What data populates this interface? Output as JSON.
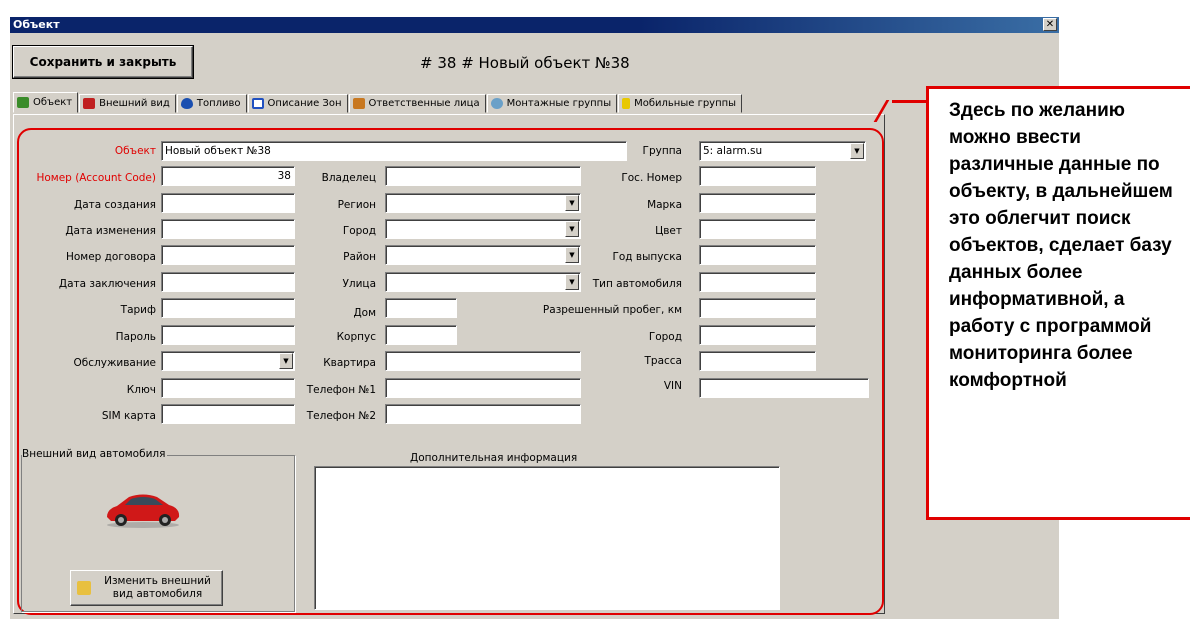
{
  "window": {
    "title": "Объект",
    "close_icon": "close-icon"
  },
  "toolbar": {
    "save_label": "Сохранить и закрыть"
  },
  "heading": "# 38 # Новый объект №38",
  "tabs": [
    {
      "label": "Объект",
      "icon": "car-icon",
      "color": "#3a8c2a"
    },
    {
      "label": "Внешний вид",
      "icon": "car-red-icon",
      "color": "#c02020"
    },
    {
      "label": "Топливо",
      "icon": "fuel-drop-icon",
      "color": "#1a4fb0"
    },
    {
      "label": "Описание Зон",
      "icon": "zone-icon",
      "color": "#2050c0"
    },
    {
      "label": "Ответственные лица",
      "icon": "people-icon",
      "color": "#c87820"
    },
    {
      "label": "Монтажные группы",
      "icon": "gear-icon",
      "color": "#6aa0c8"
    },
    {
      "label": "Мобильные группы",
      "icon": "lightning-icon",
      "color": "#e8c800"
    }
  ],
  "form": {
    "object_label": "Объект",
    "object_value": "Новый объект №38",
    "group_label": "Группа",
    "group_value": "5: alarm.su",
    "number_label": "Номер (Account Code)",
    "number_value": "38",
    "owner_label": "Владелец",
    "gos_label": "Гос. Номер",
    "created_label": "Дата создания",
    "region_label": "Регион",
    "brand_label": "Марка",
    "changed_label": "Дата изменения",
    "city_label": "Город",
    "color_label": "Цвет",
    "contract_label": "Номер договора",
    "district_label": "Район",
    "year_label": "Год выпуска",
    "contract_date_label": "Дата заключения",
    "street_label": "Улица",
    "cartype_label": "Тип автомобиля",
    "tariff_label": "Тариф",
    "house_label": "Дом",
    "mileage_label": "Разрешенный пробег, км",
    "password_label": "Пароль",
    "building_label": "Корпус",
    "city2_label": "Город",
    "service_label": "Обслуживание",
    "flat_label": "Квартира",
    "route_label": "Трасса",
    "key_label": "Ключ",
    "phone1_label": "Телефон №1",
    "vin_label": "VIN",
    "sim_label": "SIM карта",
    "phone2_label": "Телефон №2"
  },
  "appearance": {
    "group_label": "Внешний вид автомобиля",
    "change_button": "Изменить внешний вид автомобиля"
  },
  "extra_label": "Дополнительная информация",
  "note": "Здесь по желанию можно ввести различные данные по объекту, в дальнейшем это облегчит поиск объектов, сделает базу данных более информативной, а работу с программой мониторинга более комфортной",
  "colors": {
    "accent_red": "#e00000",
    "title_blue": "#0a246a",
    "face": "#d4d0c8"
  }
}
